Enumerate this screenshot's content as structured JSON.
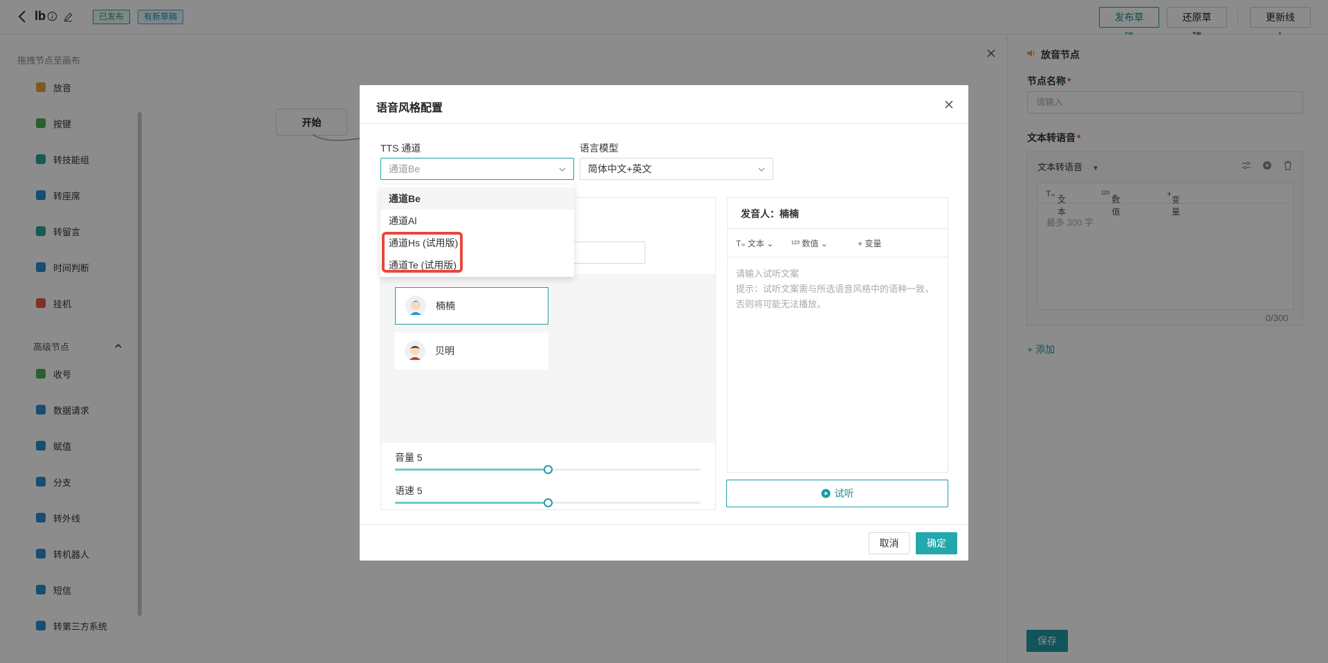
{
  "topbar": {
    "title": "lb",
    "badge_published": "已发布",
    "badge_draft": "有新草稿",
    "btn_publish": "发布草稿",
    "btn_restore": "还原草稿",
    "btn_update": "更新线上"
  },
  "left": {
    "hint": "拖拽节点至画布",
    "nodes": [
      {
        "label": "放音",
        "icon": "speaker-icon",
        "color": "#e8a23c"
      },
      {
        "label": "按键",
        "icon": "keypad-icon",
        "color": "#4caf50"
      },
      {
        "label": "转技能组",
        "icon": "group-icon",
        "color": "#26a69a"
      },
      {
        "label": "转座席",
        "icon": "agent-icon",
        "color": "#2a8fd0"
      },
      {
        "label": "转留言",
        "icon": "message-icon",
        "color": "#26a69a"
      },
      {
        "label": "时间判断",
        "icon": "clock-icon",
        "color": "#2a8fd0"
      },
      {
        "label": "挂机",
        "icon": "hangup-icon",
        "color": "#e45a4a"
      }
    ],
    "advanced_label": "高级节点",
    "advanced_nodes": [
      {
        "label": "收号",
        "icon": "phone-icon",
        "color": "#4caf50"
      },
      {
        "label": "数据请求",
        "icon": "data-request-icon",
        "color": "#2a8fd0"
      },
      {
        "label": "赋值",
        "icon": "assign-icon",
        "color": "#2a8fd0"
      },
      {
        "label": "分支",
        "icon": "branch-icon",
        "color": "#2a8fd0"
      },
      {
        "label": "转外线",
        "icon": "external-line-icon",
        "color": "#2a8fd0"
      },
      {
        "label": "转机器人",
        "icon": "robot-icon",
        "color": "#2a8fd0"
      },
      {
        "label": "短信",
        "icon": "sms-icon",
        "color": "#2a8fd0"
      },
      {
        "label": "转第三方系统",
        "icon": "third-party-icon",
        "color": "#2a8fd0"
      }
    ]
  },
  "canvas": {
    "start_node": "开始"
  },
  "right_panel": {
    "title": "放音节点",
    "node_name_label": "节点名称",
    "node_name_placeholder": "请输入",
    "tts_label": "文本转语音",
    "tts_dropdown": "文本转语音",
    "tool_text": "文本",
    "tool_number": "数值",
    "tool_variable": "变量",
    "tts_placeholder": "最多 300 字",
    "count": "0/300",
    "add": "添加",
    "save": "保存"
  },
  "modal": {
    "title": "语音风格配置",
    "tts_channel_label": "TTS 通道",
    "tts_channel_value": "通道Be",
    "lang_model_label": "语言模型",
    "lang_model_value": "简体中文+英文",
    "dropdown_options": [
      "通道Be",
      "通道Al",
      "通道Hs (试用版)",
      "通道Te (试用版)"
    ],
    "selected_option": "通道Be",
    "voices": [
      {
        "name": "楠楠",
        "selected": true
      },
      {
        "name": "贝明",
        "selected": false
      }
    ],
    "volume_label": "音量 5",
    "volume_fraction": 0.5,
    "speed_label": "语速 5",
    "speed_fraction": 0.5,
    "speaker_label": "发音人：楠楠",
    "tool_text": "文本",
    "tool_number": "数值",
    "tool_variable": "变量",
    "preview_placeholder": "请输入试听文案",
    "preview_hint": "提示：试听文案需与所选语音风格中的语种一致，否则将可能无法播放。",
    "listen": "试听",
    "cancel": "取消",
    "ok": "确定"
  },
  "colors": {
    "accent": "#1f9aa3",
    "highlight": "#e8473c"
  }
}
